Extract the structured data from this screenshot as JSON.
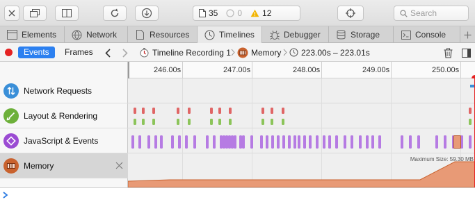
{
  "toolbar": {
    "counts": {
      "documents": "35",
      "errors": "0",
      "warnings": "12"
    },
    "search": {
      "placeholder": "Search"
    }
  },
  "tabs": [
    {
      "label": "Elements",
      "icon": "elements-icon"
    },
    {
      "label": "Network",
      "icon": "network-icon"
    },
    {
      "label": "Resources",
      "icon": "resources-icon"
    },
    {
      "label": "Timelines",
      "icon": "timelines-icon",
      "active": true
    },
    {
      "label": "Debugger",
      "icon": "debugger-icon"
    },
    {
      "label": "Storage",
      "icon": "storage-icon"
    },
    {
      "label": "Console",
      "icon": "console-icon"
    }
  ],
  "navbar": {
    "mode_events": "Events",
    "mode_frames": "Frames",
    "crumb_recording": "Timeline Recording 1",
    "crumb_memory": "Memory",
    "crumb_range": "223.00s – 223.01s"
  },
  "timelines": [
    {
      "label": "Network Requests",
      "icon": "network-requests-icon",
      "color": "#3a8fd8"
    },
    {
      "label": "Layout & Rendering",
      "icon": "layout-rendering-icon",
      "color": "#5ea23a"
    },
    {
      "label": "JavaScript & Events",
      "icon": "javascript-events-icon",
      "color": "#9b4bd3"
    },
    {
      "label": "Memory",
      "icon": "memory-icon",
      "color": "#c9622e",
      "selected": true
    }
  ],
  "ruler": {
    "ticks": [
      "246.00s",
      "247.00s",
      "248.00s",
      "249.00s",
      "250.00s"
    ]
  },
  "memory": {
    "max_label": "Maximum Size: 59.30 MB"
  },
  "colors": {
    "layout_red": "#e06666",
    "layout_green": "#8cc45a",
    "js_purple": "#b67be3",
    "memory_fill": "#e89a76",
    "accent": "#2c80f0"
  }
}
